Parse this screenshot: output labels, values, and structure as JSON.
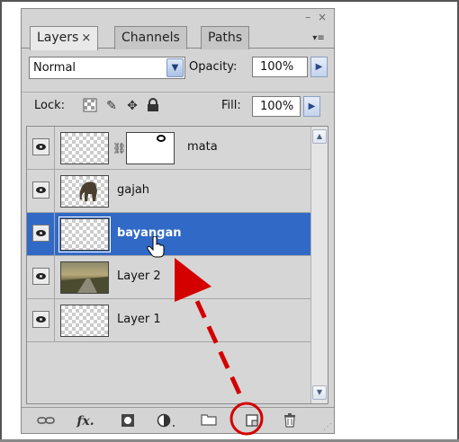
{
  "panel": {
    "window_controls": "– ×",
    "tabs": [
      {
        "label": "Layers",
        "close": "×"
      },
      {
        "label": "Channels"
      },
      {
        "label": "Paths"
      }
    ],
    "blend_mode": "Normal",
    "opacity_label": "Opacity:",
    "opacity_value": "100%",
    "lock_label": "Lock:",
    "fill_label": "Fill:",
    "fill_value": "100%"
  },
  "layers": [
    {
      "name": "mata",
      "visible": true,
      "selected": false,
      "has_mask": true,
      "thumb": "transparent"
    },
    {
      "name": "gajah",
      "visible": true,
      "selected": false,
      "has_mask": false,
      "thumb": "elephant"
    },
    {
      "name": "bayangan",
      "visible": true,
      "selected": true,
      "has_mask": false,
      "thumb": "transparent"
    },
    {
      "name": "Layer 2",
      "visible": true,
      "selected": false,
      "has_mask": false,
      "thumb": "landscape"
    },
    {
      "name": "Layer 1",
      "visible": true,
      "selected": false,
      "has_mask": false,
      "thumb": "transparent"
    }
  ],
  "bottom_icons": [
    "link-layers-icon",
    "fx-icon",
    "add-mask-icon",
    "adjustment-layer-icon",
    "new-group-icon",
    "new-layer-icon",
    "trash-icon"
  ],
  "colors": {
    "selection": "#3169c6",
    "annotation": "#d40000"
  }
}
